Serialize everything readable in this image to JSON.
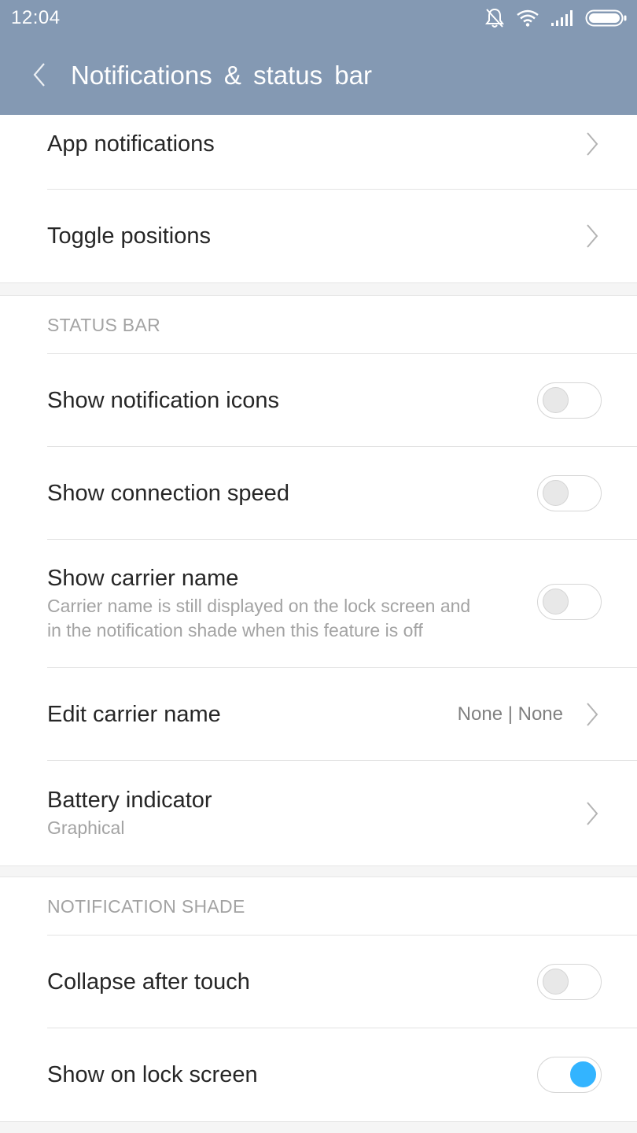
{
  "status_bar": {
    "time": "12:04",
    "icons": [
      "bell-off-icon",
      "wifi-icon",
      "signal-icon",
      "battery-icon"
    ]
  },
  "header": {
    "title": "Notifications & status bar",
    "back_icon": "chevron-left-icon"
  },
  "colors": {
    "header_bg": "#8499b3",
    "toggle_on": "#33b4ff"
  },
  "top_items": [
    {
      "label": "App notifications"
    },
    {
      "label": "Toggle positions"
    }
  ],
  "status_bar_section": {
    "header": "STATUS BAR",
    "show_notification_icons": {
      "label": "Show notification icons",
      "on": false
    },
    "show_connection_speed": {
      "label": "Show connection speed",
      "on": false
    },
    "show_carrier_name": {
      "label": "Show carrier name",
      "description_line1": "Carrier name is still displayed on the lock screen and",
      "description_line2": "in the notification shade when this feature is off",
      "on": false
    },
    "edit_carrier_name": {
      "label": "Edit carrier name",
      "value": "None | None"
    },
    "battery_indicator": {
      "label": "Battery indicator",
      "value": "Graphical"
    }
  },
  "notification_shade_section": {
    "header": "NOTIFICATION SHADE",
    "collapse_after_touch": {
      "label": "Collapse after touch",
      "on": false
    },
    "show_on_lock_screen": {
      "label": "Show on lock screen",
      "on": true
    }
  }
}
